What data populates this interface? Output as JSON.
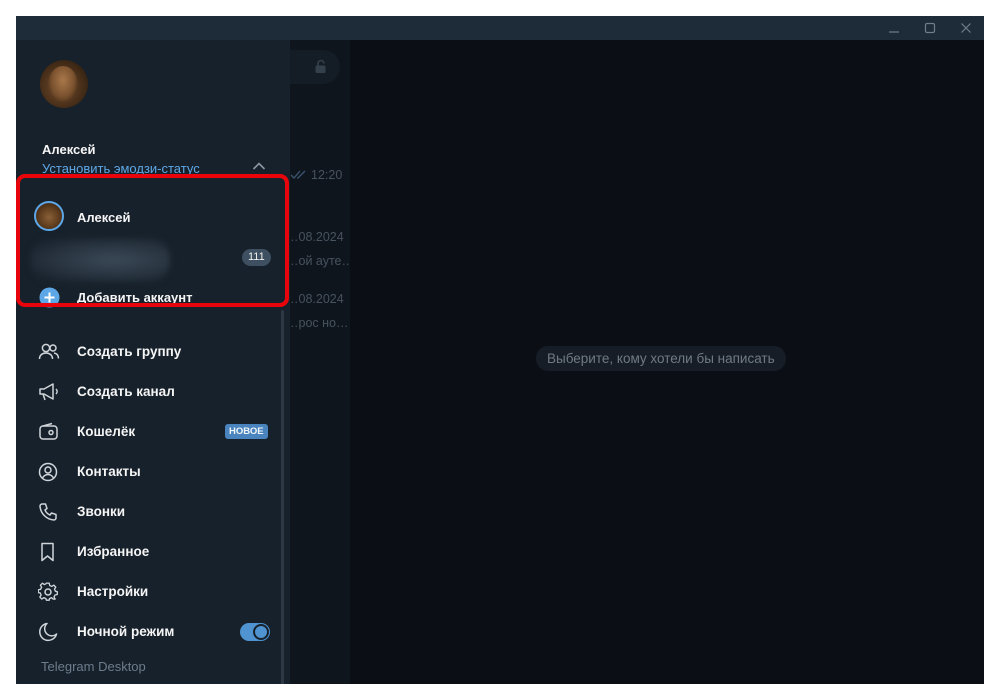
{
  "window": {
    "controls": [
      "minimize-icon",
      "maximize-icon",
      "close-icon"
    ]
  },
  "chatlist": {
    "items": [
      {
        "time": "12:20",
        "preview": ""
      },
      {
        "date": "…08.2024",
        "preview": "…ой ауте…"
      },
      {
        "date": "…08.2024",
        "preview": "…рос но…"
      }
    ]
  },
  "chat": {
    "empty_hint": "Выберите, кому хотели бы написать"
  },
  "menu": {
    "profile": {
      "name": "Алексей",
      "set_status": "Установить эмодзи-статус"
    },
    "accounts": {
      "current": "Алексей",
      "second_unread": "111",
      "add_account": "Добавить аккаунт"
    },
    "items": [
      {
        "label": "Создать группу",
        "icon": "group-icon"
      },
      {
        "label": "Создать канал",
        "icon": "megaphone-icon"
      },
      {
        "label": "Кошелёк",
        "icon": "wallet-icon",
        "badge": "НОВОЕ"
      },
      {
        "label": "Контакты",
        "icon": "contact-icon"
      },
      {
        "label": "Звонки",
        "icon": "phone-icon"
      },
      {
        "label": "Избранное",
        "icon": "bookmark-icon"
      },
      {
        "label": "Настройки",
        "icon": "gear-icon"
      },
      {
        "label": "Ночной режим",
        "icon": "moon-icon",
        "toggle": true
      }
    ],
    "app_name": "Telegram Desktop",
    "app_version": ""
  },
  "colors": {
    "accent": "#5ea7e6",
    "menu_bg": "#17212b",
    "window_bg": "#0e1621",
    "highlight": "#e8040a"
  }
}
